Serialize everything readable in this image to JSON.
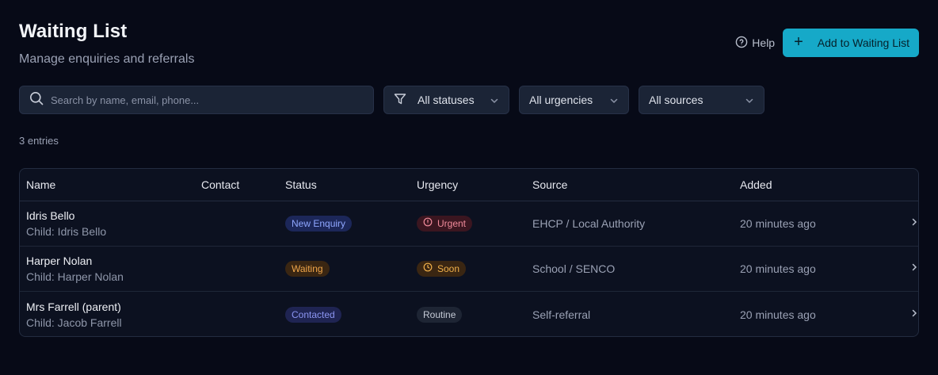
{
  "header": {
    "title": "Waiting List",
    "subtitle": "Manage enquiries and referrals",
    "help_label": "Help",
    "add_label": "Add to Waiting List"
  },
  "filters": {
    "search_placeholder": "Search by name, email, phone...",
    "status": "All statuses",
    "urgency": "All urgencies",
    "source": "All sources"
  },
  "entry_count": "3 entries",
  "table": {
    "columns": [
      "Name",
      "Contact",
      "Status",
      "Urgency",
      "Source",
      "Added"
    ],
    "rows": [
      {
        "name": "Idris Bello",
        "child": "Child: Idris Bello",
        "contact": "",
        "status": "New Enquiry",
        "urgency": "Urgent",
        "source": "EHCP / Local Authority",
        "added": "20 minutes ago"
      },
      {
        "name": "Harper Nolan",
        "child": "Child: Harper Nolan",
        "contact": "",
        "status": "Waiting",
        "urgency": "Soon",
        "source": "School / SENCO",
        "added": "20 minutes ago"
      },
      {
        "name": "Mrs Farrell (parent)",
        "child": "Child: Jacob Farrell",
        "contact": "",
        "status": "Contacted",
        "urgency": "Routine",
        "source": "Self-referral",
        "added": "20 minutes ago"
      }
    ]
  },
  "colors": {
    "background": "#070a17",
    "accent": "#16a9c8",
    "panel": "#1b2436"
  },
  "icons": {
    "help": "help-circle-icon",
    "add": "plus-icon",
    "search": "search-icon",
    "filter": "filter-icon",
    "dropdown": "chevron-down-icon",
    "urgent": "alert-circle-icon",
    "soon": "clock-icon",
    "row_open": "chevron-right-icon"
  }
}
